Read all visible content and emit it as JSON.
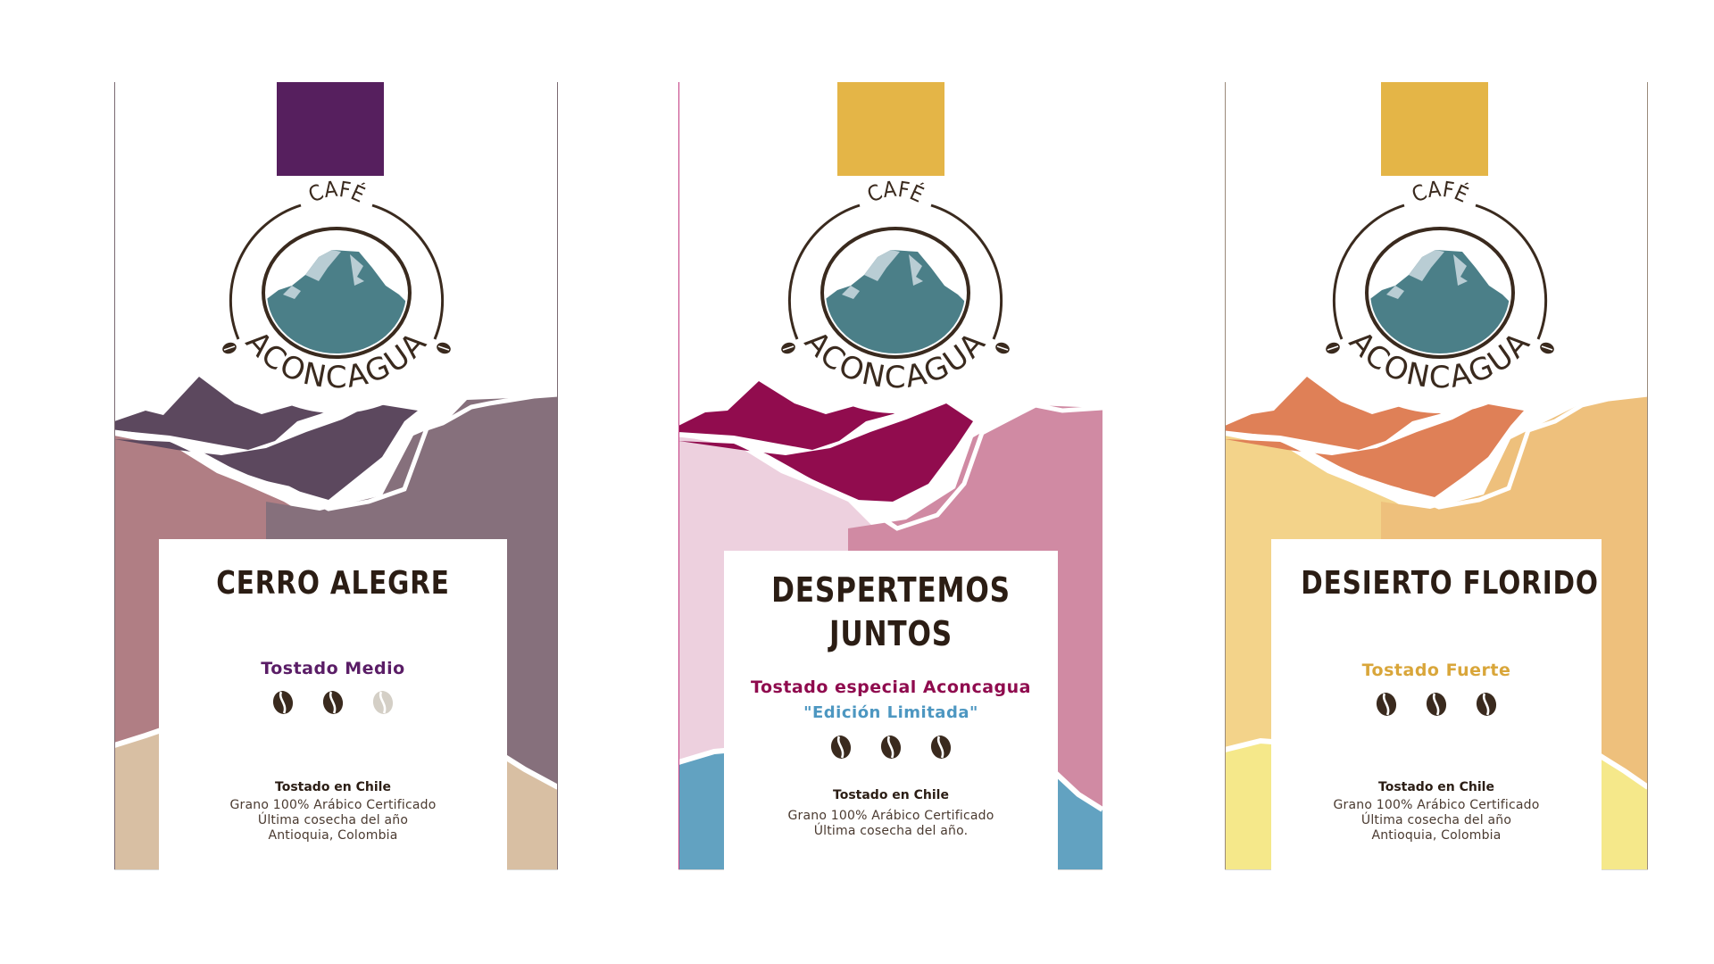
{
  "brand": {
    "top_word": "CAFÉ",
    "name": "ACONCAGUA"
  },
  "products": [
    {
      "name_line1": "CERRO ALEGRE",
      "name_line2": "",
      "roast": "Tostado Medio",
      "edition": "",
      "beans_filled": 2,
      "beans_total": 3,
      "info_title": "Tostado en Chile",
      "info_lines": [
        "Grano 100% Arábico Certificado",
        "Última cosecha del año",
        "Antioquia, Colombia"
      ],
      "colors": {
        "ribbon": "#561f5e",
        "roast_text": "#5a1d66",
        "dark": "#5c485e",
        "mid": "#b07e84",
        "right": "#86707c",
        "base": "#d8bfa3",
        "bean": "#3a2a1e",
        "bean_empty": "#d4cfc6"
      }
    },
    {
      "name_line1": "DESPERTEMOS",
      "name_line2": "JUNTOS",
      "roast": "Tostado especial Aconcagua",
      "edition": "\"Edición Limitada\"",
      "beans_filled": 3,
      "beans_total": 3,
      "info_title": "Tostado en Chile",
      "info_lines": [
        "Grano 100% Arábico Certificado",
        "Última cosecha del año."
      ],
      "colors": {
        "ribbon": "#e4b547",
        "roast_text": "#8f0b4e",
        "edition_text": "#4d97c1",
        "dark": "#910c4e",
        "mid": "#edd0de",
        "right": "#d08aa3",
        "base": "#62a2c1",
        "bean": "#3a2a1e",
        "bean_empty": "#d4cfc6"
      }
    },
    {
      "name_line1": "DESIERTO FLORIDO",
      "name_line2": "",
      "roast": "Tostado Fuerte",
      "edition": "",
      "beans_filled": 3,
      "beans_total": 3,
      "info_title": "Tostado en Chile",
      "info_lines": [
        "Grano 100% Arábico Certificado",
        "Última cosecha del año",
        "Antioquia, Colombia"
      ],
      "colors": {
        "ribbon": "#e4b547",
        "roast_text": "#d9a63a",
        "dark": "#df8057",
        "mid": "#f3d38a",
        "right": "#eec07c",
        "base": "#f5e88a",
        "bean": "#3a2a1e",
        "bean_empty": "#d4cfc6"
      }
    }
  ]
}
